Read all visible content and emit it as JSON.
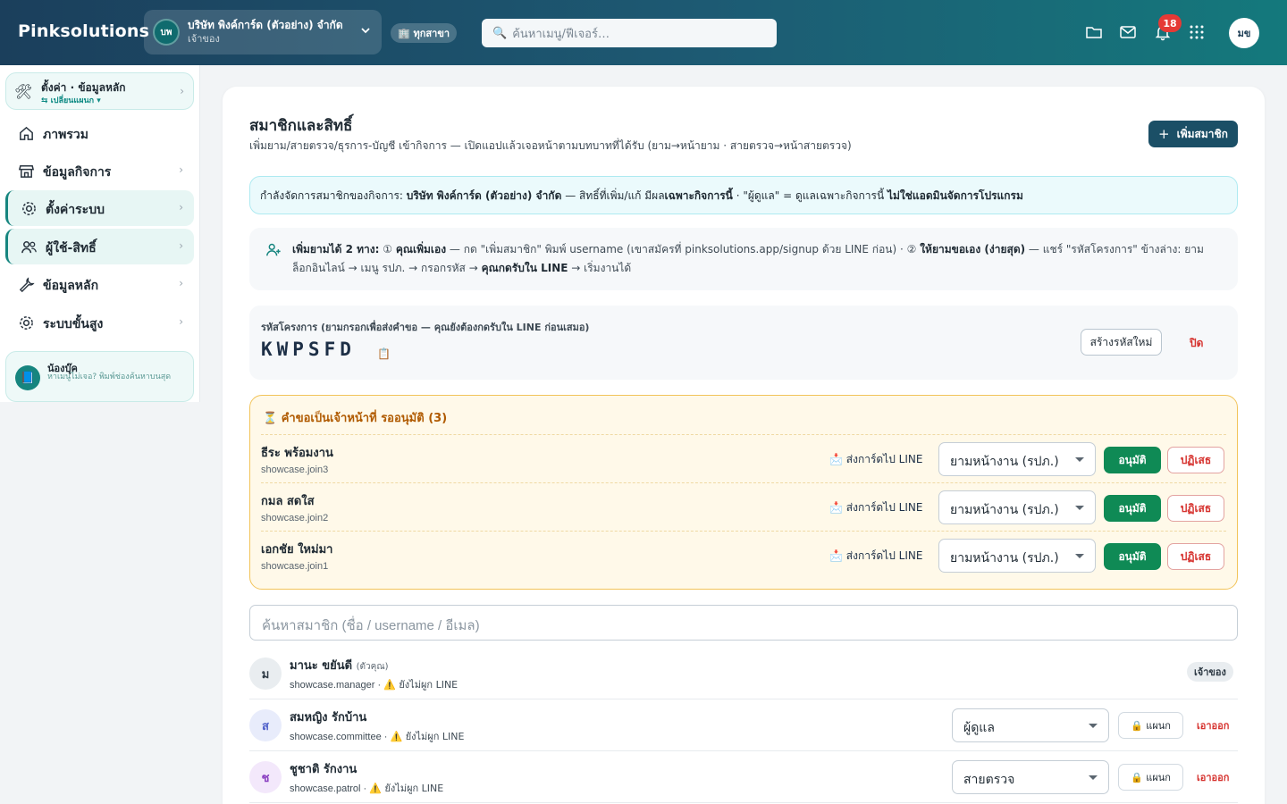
{
  "topbar": {
    "brand": "Pinksolutions",
    "org_avatar": "บพ",
    "org_name": "บริษัท พิงค์การ์ด (ตัวอย่าง) จำกัด",
    "org_role": "เจ้าของ",
    "branch_label": "🏢 ทุกสาขา",
    "search_placeholder": "ค้นหาเมนู/ฟีเจอร์…",
    "notification_count": "18",
    "user_initials": "มข",
    "icons": [
      "folder-icon",
      "mail-icon",
      "bell-icon",
      "apps-grid-icon"
    ]
  },
  "sidebar": {
    "settings_title": "ตั้งค่า · ข้อมูลหลัก",
    "settings_sub": "⇆ เปลี่ยนแผนก ▾",
    "items": [
      {
        "label": "ภาพรวม",
        "icon": "home-icon",
        "active": false,
        "chevron": false
      },
      {
        "label": "ข้อมูลกิจการ",
        "icon": "store-icon",
        "active": false,
        "chevron": true
      },
      {
        "label": "ตั้งค่าระบบ",
        "icon": "gear-icon",
        "active": true,
        "chevron": true
      },
      {
        "label": "ผู้ใช้-สิทธิ์",
        "icon": "users-icon",
        "active": true,
        "chevron": true
      },
      {
        "label": "ข้อมูลหลัก",
        "icon": "wrench-icon",
        "active": false,
        "chevron": true
      },
      {
        "label": "ระบบขั้นสูง",
        "icon": "gear-icon",
        "active": false,
        "chevron": true
      }
    ],
    "helper_title": "น้องบุ๊ค",
    "helper_text": "หาเมนูไม่เจอ? พิมพ์ช่องค้นหาบนสุด"
  },
  "main": {
    "title": "สมาชิกและสิทธิ์",
    "subtitle": "เพิ่มยาม/สายตรวจ/ธุรการ-บัญชี เข้ากิจการ — เปิดแอปแล้วเจอหน้าตามบทบาทที่ได้รับ (ยาม→หน้ายาม · สายตรวจ→หน้าสายตรวจ)",
    "add_button": "เพิ่มสมาชิก",
    "notice_prefix": "กำลังจัดการสมาชิกของกิจการ: ",
    "notice_org": "บริษัท พิงค์การ์ด (ตัวอย่าง) จำกัด",
    "notice_mid": " — สิทธิ์ที่เพิ่ม/แก้ มีผล",
    "notice_only": "เฉพาะกิจการนี้",
    "notice_mid2": " · \"ผู้ดูแล\" = ดูแลเฉพาะกิจการนี้ ",
    "notice_not_admin": "ไม่ใช่แอดมินจัดการโปรแกรม",
    "howto_lead": "เพิ่มยามได้ 2 ทาง:",
    "howto_opt1_b": "คุณเพิ่มเอง",
    "howto_opt1": " — กด \"เพิ่มสมาชิก\" พิมพ์ username (เขาสมัครที่ pinksolutions.app/signup ด้วย LINE ก่อน) · ② ",
    "howto_opt2_b": "ให้ยามขอเอง (ง่ายสุด)",
    "howto_opt2": " — แชร์ \"รหัสโครงการ\" ข้างล่าง: ยามล็อกอินไลน์ → เมนู รปภ. → กรอกรหัส → ",
    "howto_opt2_end_b": "คุณกดรับใน LINE",
    "howto_opt2_end": " → เริ่มงานได้",
    "code_label": "รหัสโครงการ (ยามกรอกเพื่อส่งคำขอ — คุณยังต้องกดรับใน LINE ก่อนเสมอ)",
    "project_code": "KWPSFD",
    "regen_button": "สร้างรหัสใหม่",
    "close_button": "ปิด",
    "pending_title": "⏳ คำขอเป็นเจ้าหน้าที่ รออนุมัติ (3)",
    "pending": [
      {
        "name": "ธีระ พร้อมงาน",
        "username": "showcase.join3",
        "send_line": "📩 ส่งการ์ดไป LINE",
        "role": "ยามหน้างาน (รปภ.)",
        "approve": "อนุมัติ",
        "reject": "ปฏิเสธ"
      },
      {
        "name": "กมล สดใส",
        "username": "showcase.join2",
        "send_line": "📩 ส่งการ์ดไป LINE",
        "role": "ยามหน้างาน (รปภ.)",
        "approve": "อนุมัติ",
        "reject": "ปฏิเสธ"
      },
      {
        "name": "เอกชัย ใหม่มา",
        "username": "showcase.join1",
        "send_line": "📩 ส่งการ์ดไป LINE",
        "role": "ยามหน้างาน (รปภ.)",
        "approve": "อนุมัติ",
        "reject": "ปฏิเสธ"
      }
    ],
    "member_search_placeholder": "ค้นหาสมาชิก (ชื่อ / username / อีเมล)",
    "members": [
      {
        "initial": "ม",
        "name": "มานะ ขยันดี",
        "you": "(ตัวคุณ)",
        "username": "showcase.manager",
        "line_status": "⚠️ ยังไม่ผูก LINE",
        "badge": "เจ้าของ",
        "avatar_bg": "#e9edf0",
        "avatar_fg": "#2f3b45"
      },
      {
        "initial": "ส",
        "name": "สมหญิง รักบ้าน",
        "you": "",
        "username": "showcase.committee",
        "line_status": "⚠️ ยังไม่ผูก LINE",
        "role": "ผู้ดูแล",
        "dept": "🔒 แผนก",
        "kick": "เอาออก",
        "avatar_bg": "#e8ecfb",
        "avatar_fg": "#4e5fc9"
      },
      {
        "initial": "ช",
        "name": "ชูชาติ รักงาน",
        "you": "",
        "username": "showcase.patrol",
        "line_status": "⚠️ ยังไม่ผูก LINE",
        "role": "สายตรวจ",
        "dept": "🔒 แผนก",
        "kick": "เอาออก",
        "avatar_bg": "#f3e8fb",
        "avatar_fg": "#8a3fc1"
      }
    ]
  }
}
